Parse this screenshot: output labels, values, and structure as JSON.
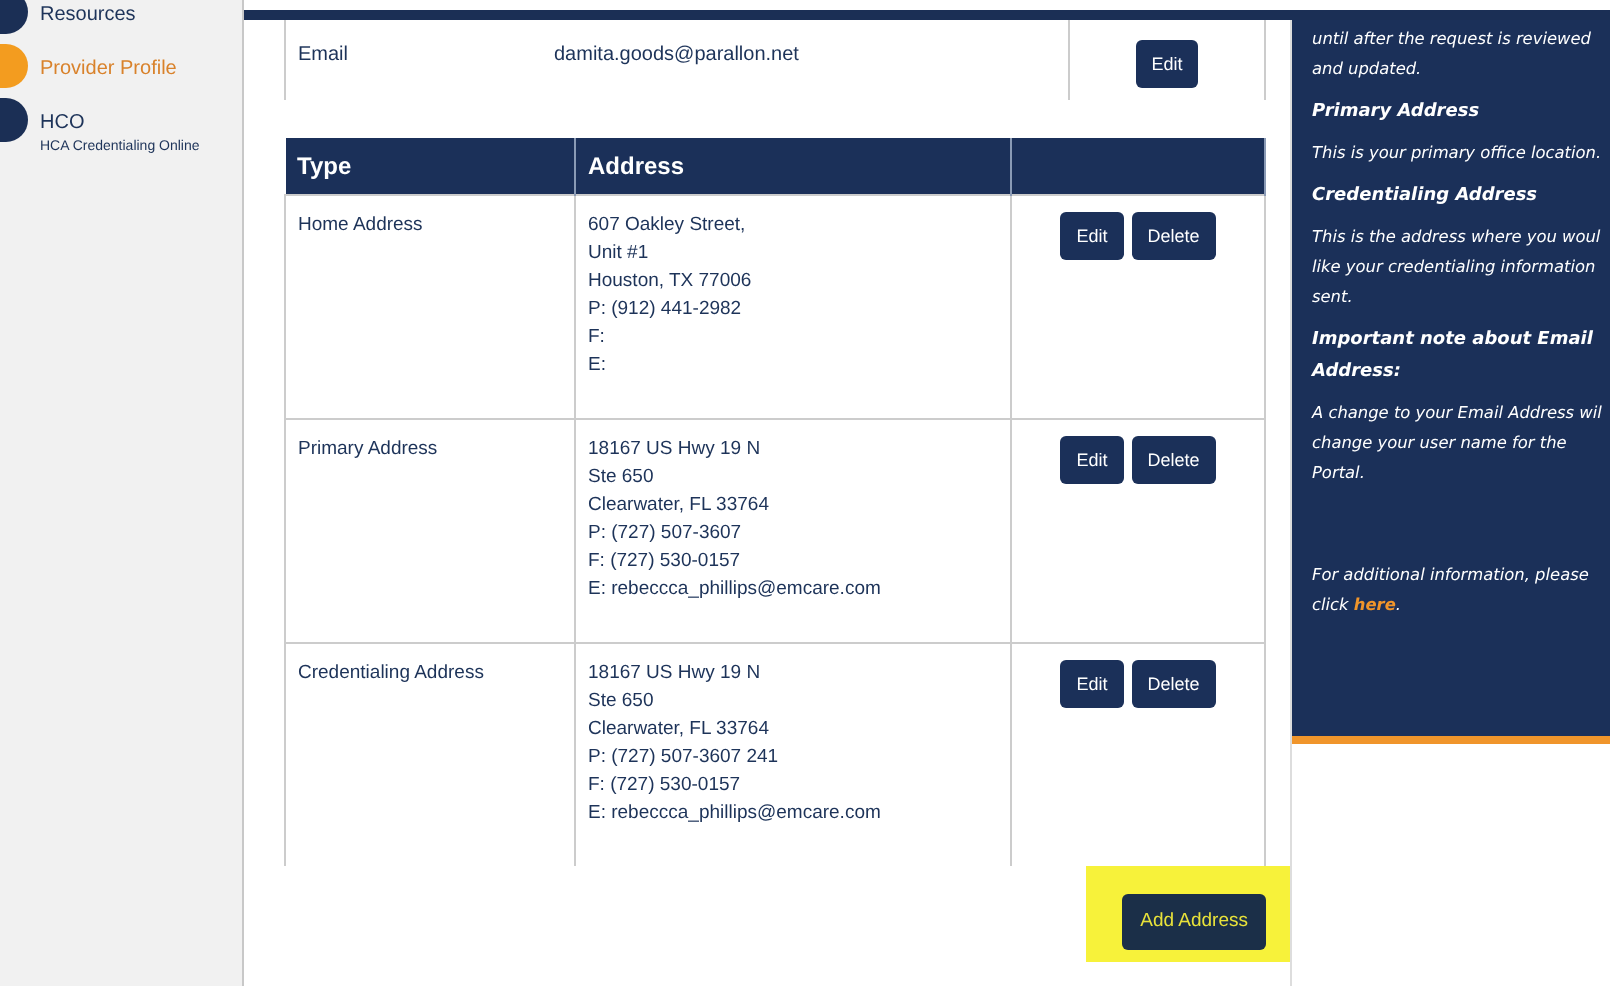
{
  "sidebar": {
    "items": [
      {
        "label": "Resources",
        "selected": false
      },
      {
        "label": "Provider Profile",
        "selected": true
      },
      {
        "label": "HCO",
        "subtitle": "HCA Credentialing Online",
        "selected": false
      }
    ]
  },
  "email_row": {
    "label": "Email",
    "value": "damita.goods@parallon.net",
    "button": "Edit"
  },
  "address_table": {
    "columns": [
      "Type",
      "Address"
    ],
    "rows": [
      {
        "type": "Home Address",
        "lines": [
          "607 Oakley Street,",
          "Unit #1",
          "Houston, TX 77006",
          "P: (912) 441-2982",
          "F:",
          "E:"
        ],
        "buttons": [
          "Edit",
          "Delete"
        ]
      },
      {
        "type": "Primary Address",
        "lines": [
          "18167 US Hwy 19 N",
          "Ste 650",
          "Clearwater, FL 33764",
          "P: (727) 507-3607",
          "F: (727) 530-0157",
          "E: rebeccca_phillips@emcare.com"
        ],
        "buttons": [
          "Edit",
          "Delete"
        ]
      },
      {
        "type": "Credentialing Address",
        "lines": [
          "18167 US Hwy 19 N",
          "Ste 650",
          "Clearwater, FL 33764",
          "P: (727) 507-3607 241",
          "F: (727) 530-0157",
          "E: rebeccca_phillips@emcare.com"
        ],
        "buttons": [
          "Edit",
          "Delete"
        ]
      }
    ]
  },
  "add_button": {
    "label": "Add Address",
    "highlighted": true
  },
  "help_panel": {
    "blocks": [
      {
        "kind": "text",
        "lines": [
          "until after the request is reviewed",
          "and updated."
        ]
      },
      {
        "kind": "heading",
        "lines": [
          "Primary Address"
        ]
      },
      {
        "kind": "text",
        "lines": [
          "This is your primary office location."
        ]
      },
      {
        "kind": "heading",
        "lines": [
          "Credentialing Address"
        ]
      },
      {
        "kind": "text",
        "lines": [
          "This is the address where you woul",
          "like your credentialing information",
          "sent."
        ]
      },
      {
        "kind": "heading",
        "lines": [
          "Important note about Email",
          "Address:"
        ]
      },
      {
        "kind": "text",
        "lines": [
          "A change to your Email Address wil",
          "change your user name for the",
          "Portal."
        ]
      },
      {
        "kind": "link_text",
        "lines": [
          "For additional information, please",
          "click "
        ],
        "link": "here",
        "after": "."
      }
    ]
  }
}
